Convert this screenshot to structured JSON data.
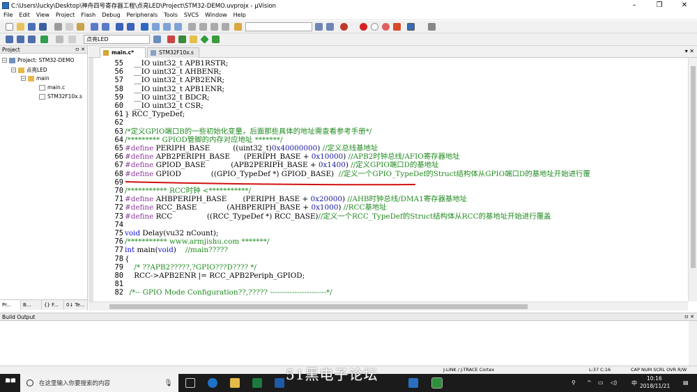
{
  "window": {
    "title": "C:\\Users\\lucky\\Desktop\\神舟四号寄存器工程\\点亮LED\\Project\\STM32-DEMO.uvprojx - µVision",
    "minimize": "–",
    "maximize": "❐",
    "close": "✕"
  },
  "menu": [
    "File",
    "Edit",
    "View",
    "Project",
    "Flash",
    "Debug",
    "Peripherals",
    "Tools",
    "SVCS",
    "Window",
    "Help"
  ],
  "toolbar": {
    "target_name": "点亮LED"
  },
  "project_panel": {
    "title": "Project",
    "pin": "ㅁ ✕",
    "root": "Project: STM32-DEMO",
    "target": "点亮LED",
    "group": "main",
    "files": [
      "main.c",
      "STM32F10x.s"
    ],
    "tabs": [
      "Pr...",
      "B...",
      "{} F...",
      "0↓ Te..."
    ]
  },
  "editor": {
    "tabs": [
      {
        "label": "main.c*"
      },
      {
        "label": "STM32F10x.s"
      }
    ],
    "lines": [
      {
        "n": "55",
        "code": "    __IO uint32_t APB1RSTR;"
      },
      {
        "n": "56",
        "code": "    __IO uint32_t AHBENR;"
      },
      {
        "n": "57",
        "code": "    __IO uint32_t APB2ENR;"
      },
      {
        "n": "58",
        "code": "    __IO uint32_t APB1ENR;"
      },
      {
        "n": "59",
        "code": "    __IO uint32_t BDCR;"
      },
      {
        "n": "60",
        "code": "    __IO uint32_t CSR;"
      },
      {
        "n": "61",
        "code": "} RCC_TypeDef;"
      },
      {
        "n": "62",
        "code": ""
      },
      {
        "n": "63",
        "code": "/*定义GPIO端口B的一些初始化变量，后面那些具体的地址需查看参考手册*/"
      },
      {
        "n": "64",
        "code": "/********* GPIOD管脚的内存对应地址 *******/"
      },
      {
        "n": "65",
        "code": "#define PERIPH_BASE          ((uint32_t)0x40000000) //定义总线基地址"
      },
      {
        "n": "66",
        "code": "#define APB2PERIPH_BASE      (PERIPH_BASE + 0x10000) //APB2时钟总线/AFIO寄存器地址"
      },
      {
        "n": "67",
        "code": "#define GPIOD_BASE           (APB2PERIPH_BASE + 0x1400) //定义GPIO端口D的基地址"
      },
      {
        "n": "68",
        "code": "#define GPIOD             ((GPIO_TypeDef *) GPIOD_BASE)  //定义一个GPIO_TypeDef的Struct结构体从GPIO端口D的基地址开始进行覆"
      },
      {
        "n": "69",
        "code": ""
      },
      {
        "n": "70",
        "code": "/*********** RCC时钟 <***********/"
      },
      {
        "n": "71",
        "code": "#define AHBPERIPH_BASE       (PERIPH_BASE + 0x20000) //AHB时钟总线/DMA1寄存器基地址"
      },
      {
        "n": "72",
        "code": "#define RCC_BASE             (AHBPERIPH_BASE + 0x1000) //RCC基地址"
      },
      {
        "n": "73",
        "code": "#define RCC               ((RCC_TypeDef *) RCC_BASE)//定义一个RCC_TypeDef的Struct结构体从RCC的基地址开始进行覆盖"
      },
      {
        "n": "74",
        "code": ""
      },
      {
        "n": "75",
        "code": "void Delay(vu32 nCount);"
      },
      {
        "n": "76",
        "code": "/*********** www.armjishu.com *******/"
      },
      {
        "n": "77",
        "code": "int main(void)    //main?????"
      },
      {
        "n": "78",
        "code": "{"
      },
      {
        "n": "79",
        "code": "    /* ??APB2?????,?GPIO???D???? */"
      },
      {
        "n": "80",
        "code": "    RCC->APB2ENR |= RCC_APB2Periph_GPIOD;"
      },
      {
        "n": "81",
        "code": ""
      },
      {
        "n": "82",
        "code": "  /*-- GPIO Mode Configuration??,????? -----------------------*/"
      }
    ]
  },
  "build_output": {
    "title": "Build Output"
  },
  "status": {
    "debugger": "J-LINK / J-TRACE Cortex",
    "position": "L:37 C:16",
    "flags": "CAP  NUM  SCRL  OVR  R/W"
  },
  "taskbar": {
    "search_placeholder": "在这里输入你要搜索的内容",
    "time": "10:16",
    "date": "2018/11/21",
    "ime": "中"
  },
  "watermark": "51黑电子论坛"
}
